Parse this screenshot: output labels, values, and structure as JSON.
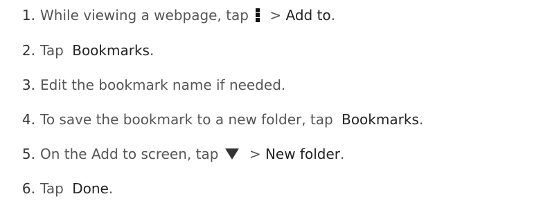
{
  "steps": [
    {
      "num": "1.",
      "text1": "While viewing a webpage, tap",
      "icon": "menu-icon",
      "text2": " > ",
      "bold1": "Add to",
      "text3": "."
    },
    {
      "num": "2.",
      "text1": "Tap ",
      "bold1": "Bookmarks",
      "text2": "."
    },
    {
      "num": "3.",
      "text1": "Edit the bookmark name if needed."
    },
    {
      "num": "4.",
      "text1": "To save the bookmark to a new folder, tap ",
      "bold1": "Bookmarks",
      "text2": "."
    },
    {
      "num": "5.",
      "text1": "On the Add to screen, tap",
      "icon": "dropdown-triangle-icon",
      "text2": " > ",
      "bold1": "New folder",
      "text3": "."
    },
    {
      "num": "6.",
      "text1": "Tap ",
      "bold1": "Done",
      "text2": "."
    }
  ]
}
